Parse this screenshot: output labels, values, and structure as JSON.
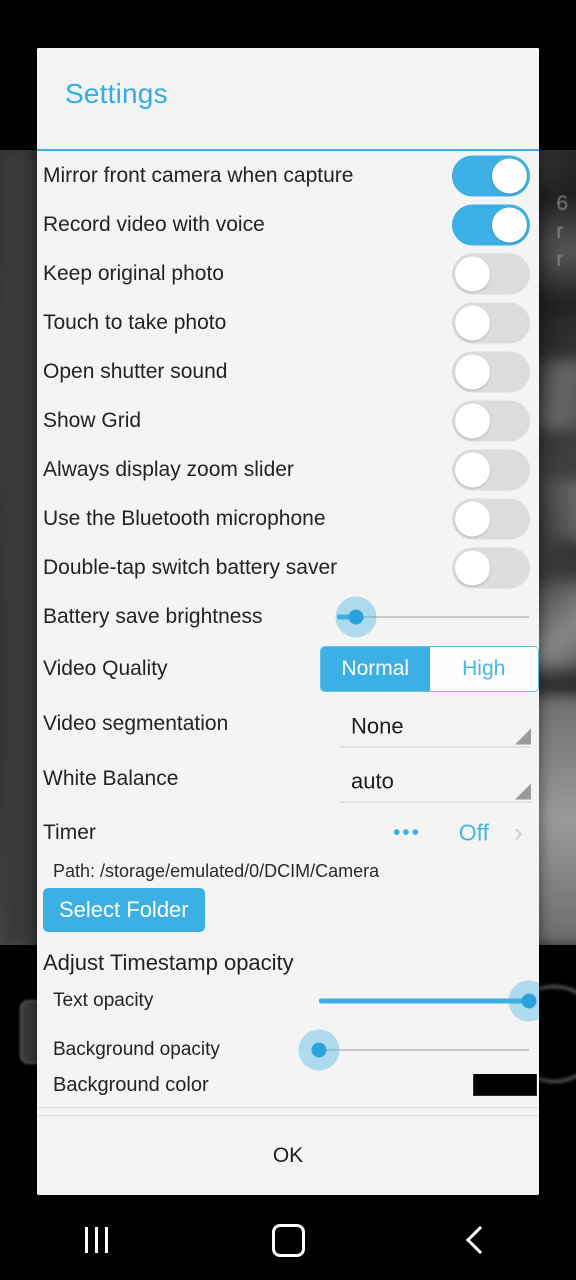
{
  "dialog": {
    "title": "Settings",
    "ok_label": "OK"
  },
  "toggles": [
    {
      "label": "Mirror front camera when capture",
      "state": "on"
    },
    {
      "label": "Record video with voice",
      "state": "on"
    },
    {
      "label": "Keep original photo",
      "state": "off"
    },
    {
      "label": "Touch to take photo",
      "state": "off"
    },
    {
      "label": "Open shutter sound",
      "state": "off"
    },
    {
      "label": "Show Grid",
      "state": "off"
    },
    {
      "label": "Always display zoom slider",
      "state": "off"
    },
    {
      "label": "Use the Bluetooth microphone",
      "state": "off"
    },
    {
      "label": "Double-tap switch battery saver",
      "state": "off"
    }
  ],
  "brightness": {
    "label": "Battery save brightness",
    "value_percent": 10
  },
  "video_quality": {
    "label": "Video Quality",
    "options": [
      "Normal",
      "High"
    ],
    "selected": "Normal"
  },
  "video_segmentation": {
    "label": "Video segmentation",
    "value": "None"
  },
  "white_balance": {
    "label": "White Balance",
    "value": "auto"
  },
  "timer": {
    "label": "Timer",
    "dots": "•••",
    "value": "Off",
    "chevron": "›"
  },
  "storage": {
    "path_text": "Path: /storage/emulated/0/DCIM/Camera",
    "select_folder_label": "Select Folder"
  },
  "timestamp": {
    "section_title": "Adjust Timestamp opacity",
    "text_opacity": {
      "label": "Text opacity",
      "value_percent": 100
    },
    "background_opacity": {
      "label": "Background opacity",
      "value_percent": 0
    },
    "background_color": {
      "label": "Background color",
      "swatch_color": "#000000"
    }
  },
  "navbar": {
    "recents_label": "recents-icon",
    "home_label": "home-icon",
    "back_label": "back-icon"
  },
  "backdrop": {
    "ghost_text_line1": "6",
    "ghost_text_line2": "r",
    "ghost_text_line3": "r"
  },
  "colors": {
    "accent": "#3cb0e4",
    "title": "#33ade4",
    "text": "#232323",
    "track_off": "#dcdcdc"
  }
}
